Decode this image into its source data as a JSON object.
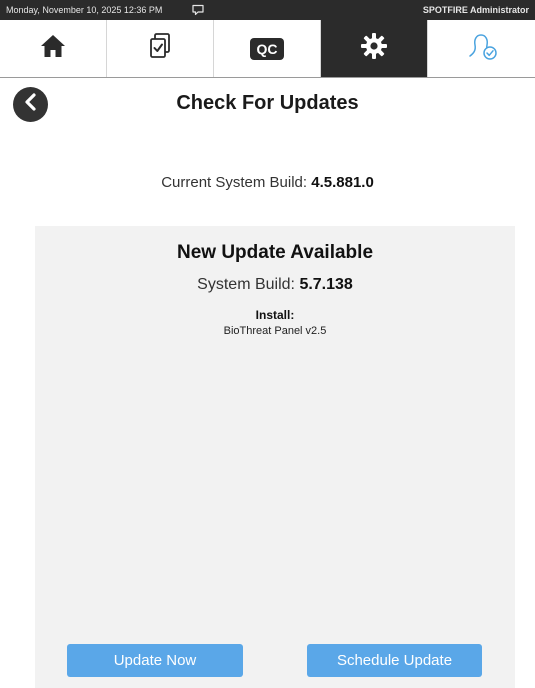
{
  "status_bar": {
    "datetime": "Monday, November 10, 2025 12:36 PM",
    "user": "SPOTFIRE Administrator"
  },
  "nav": {
    "items": [
      {
        "name": "home",
        "icon": "home-icon"
      },
      {
        "name": "checklist",
        "icon": "checklist-icon"
      },
      {
        "name": "qc",
        "icon": "qc-icon",
        "label": "QC"
      },
      {
        "name": "settings",
        "icon": "gear-icon",
        "active": true
      },
      {
        "name": "user",
        "icon": "user-verified-icon"
      }
    ]
  },
  "header": {
    "title": "Check For Updates",
    "back_icon": "chevron-left-icon"
  },
  "current_build": {
    "label": "Current System Build:",
    "value": "4.5.881.0"
  },
  "update": {
    "heading": "New Update Available",
    "build_label": "System Build:",
    "build_value": "5.7.138",
    "install_label": "Install:",
    "install_item": "BioThreat Panel v2.5"
  },
  "buttons": {
    "update_now": "Update Now",
    "schedule_update": "Schedule Update"
  },
  "colors": {
    "status_bar_bg": "#2b2b2b",
    "active_nav_bg": "#2b2b2b",
    "button_blue": "#5aa7e8",
    "panel_bg": "#f2f2f2",
    "user_icon_blue": "#4aa3df"
  }
}
